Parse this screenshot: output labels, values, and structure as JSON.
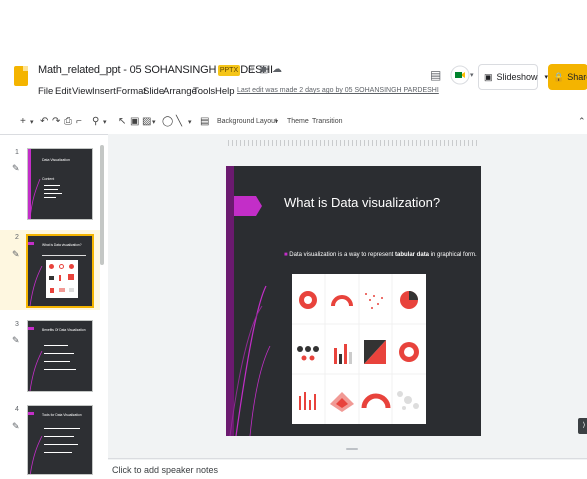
{
  "app": {
    "doc_title": "Math_related_ppt - 05 SOHANSINGH PARDESHI",
    "file_badge": "PPTX",
    "last_edit": "Last edit was made 2 days ago by 05 SOHANSINGH PARDESHI",
    "slideshow_label": "Slideshow",
    "share_label": "Share"
  },
  "menu": [
    "File",
    "Edit",
    "View",
    "Insert",
    "Format",
    "Slide",
    "Arrange",
    "Tools",
    "Help"
  ],
  "toolbar": {
    "background_label": "Background",
    "layout_label": "Layout",
    "theme_label": "Theme",
    "transition_label": "Transition"
  },
  "slides": [
    {
      "number": "1",
      "title": "Data Visualization",
      "sub": "Content"
    },
    {
      "number": "2",
      "title": "What is Data visualization?",
      "sub": ""
    },
    {
      "number": "3",
      "title": "Benefits Of Data Visualization",
      "sub": ""
    },
    {
      "number": "4",
      "title": "Tools for Data Visualization",
      "sub": ""
    }
  ],
  "current_slide": {
    "title": "What is Data visualization?",
    "bullet_before": "Data visualization is a way to represent ",
    "bullet_bold": "tabular data",
    "bullet_after": " in graphical form."
  },
  "notes_placeholder": "Click to add speaker notes",
  "colors": {
    "accent_magenta": "#c32ec8",
    "share_yellow": "#f4b400",
    "slide_dark": "#2b2d31",
    "chart_red": "#e8433c"
  }
}
